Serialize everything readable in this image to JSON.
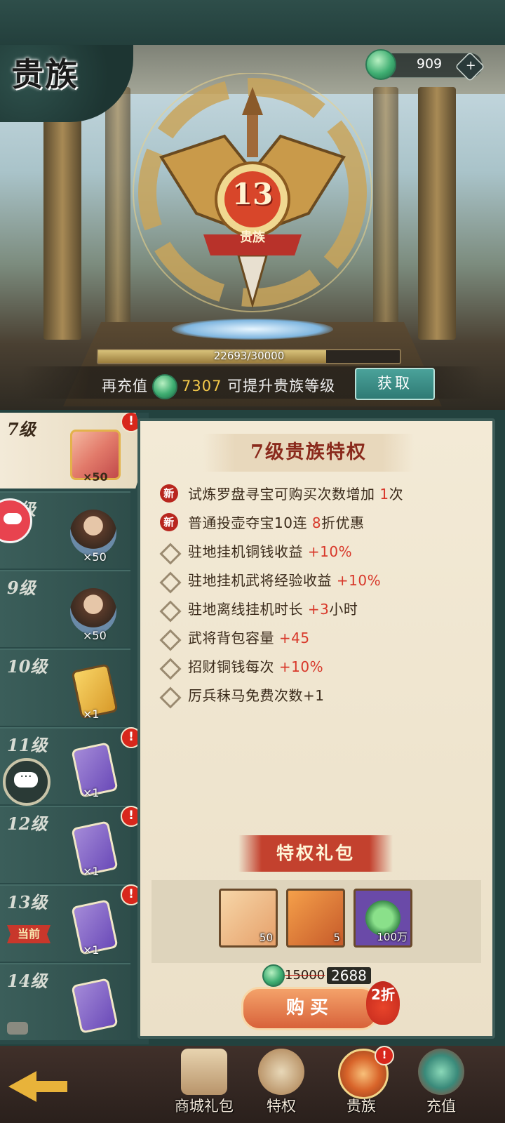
{
  "header": {
    "title": "贵族",
    "currency": {
      "amount": "909",
      "icon": "jade-coin-icon",
      "add_icon": "plus-icon"
    }
  },
  "noble": {
    "current_level": "13",
    "badge_label": "贵族",
    "progress_text": "22693/30000",
    "progress_fraction": 0.7564,
    "recharge_prefix": "再充值",
    "recharge_amount": "7307",
    "recharge_suffix": "可提升贵族等级",
    "get_button": "获取"
  },
  "levels": [
    {
      "label": "7级",
      "count": "×50",
      "icon": "gift-pack-icon",
      "red_dot": true,
      "active": true
    },
    {
      "label": "8级",
      "count": "×50",
      "icon": "hero-portrait-icon",
      "red_dot": false
    },
    {
      "label": "9级",
      "count": "×50",
      "icon": "hero-portrait-icon",
      "red_dot": false
    },
    {
      "label": "10级",
      "count": "×1",
      "icon": "gold-card-icon",
      "red_dot": false
    },
    {
      "label": "11级",
      "count": "×1",
      "icon": "purple-card-icon",
      "red_dot": true
    },
    {
      "label": "12级",
      "count": "×1",
      "icon": "purple-card-icon",
      "red_dot": true
    },
    {
      "label": "13级",
      "count": "×1",
      "icon": "purple-card-icon",
      "red_dot": true,
      "tag": "当前"
    },
    {
      "label": "14级",
      "count": "",
      "icon": "purple-card-icon",
      "red_dot": false
    }
  ],
  "red_dot_mark": "!",
  "panel": {
    "title": "7级贵族特权",
    "privileges": [
      {
        "badge": "新",
        "text": "试炼罗盘寻宝可购买次数增加",
        "value": "1",
        "suffix": "次"
      },
      {
        "badge": "新",
        "text": "普通投壶夺宝10连",
        "value": "8",
        "suffix": "折优惠"
      },
      {
        "badge": "",
        "text": "驻地挂机铜钱收益",
        "value": "+10%",
        "suffix": ""
      },
      {
        "badge": "",
        "text": "驻地挂机武将经验收益",
        "value": "+10%",
        "suffix": ""
      },
      {
        "badge": "",
        "text": "驻地离线挂机时长",
        "value": "+3",
        "suffix": "小时"
      },
      {
        "badge": "",
        "text": "武将背包容量",
        "value": "+45",
        "suffix": ""
      },
      {
        "badge": "",
        "text": "招财铜钱每次",
        "value": "+10%",
        "suffix": ""
      },
      {
        "badge": "",
        "text": "厉兵秣马免费次数+1",
        "value": "",
        "suffix": ""
      }
    ]
  },
  "gift": {
    "title": "特权礼包",
    "items": [
      {
        "icon": "gift-pack-icon",
        "count": "50"
      },
      {
        "icon": "orange-card-icon",
        "count": "5"
      },
      {
        "icon": "jade-orb-icon",
        "count": "100万"
      }
    ],
    "old_price": "15000",
    "new_price": "2688",
    "buy_label": "购买",
    "discount": "2折"
  },
  "bottom_nav": {
    "back_icon": "back-arrow-icon",
    "items": [
      {
        "label": "商城礼包",
        "icon": "shop-gift-icon"
      },
      {
        "label": "特权",
        "icon": "privilege-icon"
      },
      {
        "label": "贵族",
        "icon": "noble-icon",
        "red_dot": true,
        "selected": true
      },
      {
        "label": "充值",
        "icon": "recharge-bag-icon"
      }
    ]
  },
  "colors": {
    "accent_red": "#d8382a",
    "gold": "#f4c94a",
    "teal_button": "#3a8f88",
    "panel_bg": "#f3ead6"
  }
}
